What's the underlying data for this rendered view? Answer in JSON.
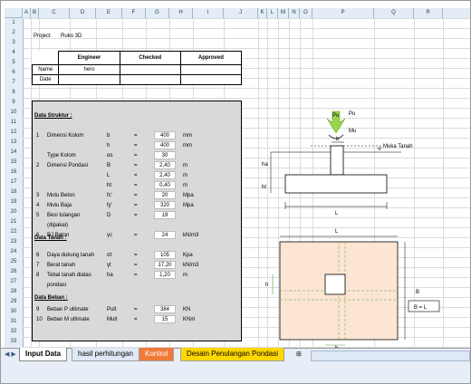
{
  "columns": [
    "A",
    "B",
    "C",
    "D",
    "E",
    "F",
    "G",
    "H",
    "I",
    "J",
    "K",
    "L",
    "M",
    "N",
    "O",
    "P",
    "Q",
    "R"
  ],
  "rows": [
    "1",
    "2",
    "3",
    "4",
    "5",
    "6",
    "7",
    "8",
    "9",
    "10",
    "11",
    "12",
    "13",
    "14",
    "15",
    "16",
    "17",
    "18",
    "19",
    "20",
    "21",
    "22",
    "23",
    "24",
    "25",
    "26",
    "27",
    "28",
    "29",
    "30",
    "31",
    "32",
    "33",
    "34",
    "35"
  ],
  "project": {
    "label": "Project",
    "value": "Ruko 3D"
  },
  "approval": {
    "engineer": "Engineer",
    "checked": "Checked",
    "approved": "Approved",
    "name_label": "Name",
    "date_label": "Date",
    "name_value": "hero"
  },
  "struct": {
    "heading": "Data Struktur :",
    "items": [
      {
        "no": "1",
        "label": "Dimensi Kolom",
        "sym": "b",
        "eq": "=",
        "val": "400",
        "unit": "mm"
      },
      {
        "no": "",
        "label": "",
        "sym": "h",
        "eq": "=",
        "val": "400",
        "unit": "mm"
      },
      {
        "no": "",
        "label": "Type Kolom",
        "sym": "αs",
        "eq": "=",
        "val": "30",
        "unit": ""
      },
      {
        "no": "2",
        "label": "Dimensi Pondasi",
        "sym": "B",
        "eq": "=",
        "val": "2,40",
        "unit": "m"
      },
      {
        "no": "",
        "label": "",
        "sym": "L",
        "eq": "=",
        "val": "2,40",
        "unit": "m"
      },
      {
        "no": "",
        "label": "",
        "sym": "ht",
        "eq": "=",
        "val": "0,40",
        "unit": "m"
      },
      {
        "no": "3",
        "label": "Mutu Beton",
        "sym": "fc'",
        "eq": "=",
        "val": "20",
        "unit": "Mpa"
      },
      {
        "no": "4",
        "label": "Mutu Baja",
        "sym": "fy'",
        "eq": "=",
        "val": "320",
        "unit": "Mpa"
      },
      {
        "no": "5",
        "label": "Besi tulangan",
        "sym": "D",
        "eq": "=",
        "val": "19",
        "unit": ""
      },
      {
        "no": "",
        "label": "(dipakai)",
        "sym": "",
        "eq": "",
        "val": "",
        "unit": ""
      },
      {
        "no": "6",
        "label": "BJ Beton",
        "sym": "γc",
        "eq": "=",
        "val": "24",
        "unit": "kN/m3"
      }
    ]
  },
  "tanah": {
    "heading": "Data Tanah :",
    "items": [
      {
        "no": "6",
        "label": "Daya dukung tanah",
        "sym": "σt",
        "eq": "=",
        "val": "105",
        "unit": "Kpa"
      },
      {
        "no": "7",
        "label": "Berat tanah",
        "sym": "γt",
        "eq": "=",
        "val": "17,20",
        "unit": "kN/m3"
      },
      {
        "no": "8",
        "label": "Tebal tanah diatas",
        "sym": "ha",
        "eq": "=",
        "val": "1,20",
        "unit": "m"
      },
      {
        "no": "",
        "label": "pondasi",
        "sym": "",
        "eq": "",
        "val": "",
        "unit": ""
      }
    ]
  },
  "beban": {
    "heading": "Data Beban :",
    "items": [
      {
        "no": "9",
        "label": "Beban P ultimate",
        "sym": "Pult",
        "eq": "=",
        "val": "384",
        "unit": "KN"
      },
      {
        "no": "10",
        "label": "Beban M ultimate",
        "sym": "Mult",
        "eq": "=",
        "val": "15",
        "unit": "KNm"
      }
    ]
  },
  "diagram": {
    "pu": "Pu",
    "mu": "Mu",
    "b": "b",
    "muka": "Muka Tanah",
    "ha": "ha",
    "ht": "ht",
    "L": "L",
    "h": "h",
    "B": "B",
    "eq": "B = L"
  },
  "tabs": [
    "Input Data",
    "hasil perhitungan",
    "Kontrol",
    "Desain Penulangan Pondasi"
  ],
  "colors": {
    "header_bg": "#e4ecf7",
    "panel_gray": "#d9d9d9",
    "plan_fill": "#fde5d3",
    "tab_active": "#ffffff",
    "tab_kontrol": "#f07a3a",
    "tab_desain": "#ffd700"
  }
}
